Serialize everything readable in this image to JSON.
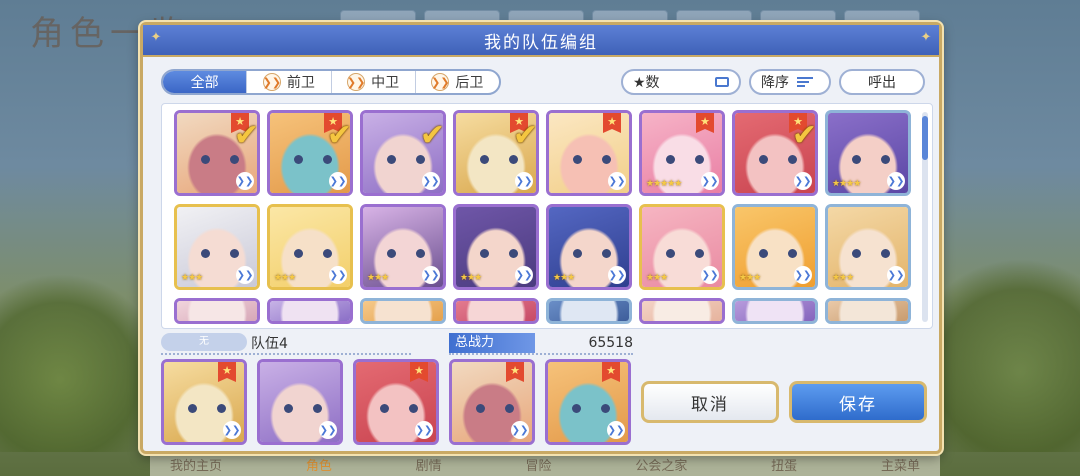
{
  "background": {
    "title": "角色一览",
    "bottom_nav": [
      "我的主页",
      "角色",
      "剧情",
      "冒险",
      "公会之家",
      "扭蛋",
      "主菜单"
    ],
    "active_nav": "角色"
  },
  "dialog": {
    "title": "我的队伍编组",
    "filter_tabs": [
      {
        "label": "全部",
        "active": true
      },
      {
        "label": "前卫",
        "active": false
      },
      {
        "label": "中卫",
        "active": false
      },
      {
        "label": "后卫",
        "active": false
      }
    ],
    "sort_field": "★数",
    "sort_order": "降序",
    "recall_label": "呼出",
    "characters": [
      {
        "frame": "purple",
        "selected": true,
        "badge": true,
        "stars": 0,
        "palette": [
          "#f1d9c0",
          "#e8a77b",
          "#c97c86"
        ]
      },
      {
        "frame": "purple",
        "selected": true,
        "badge": true,
        "stars": 0,
        "palette": [
          "#f6c27a",
          "#e39a4a",
          "#7bc2c9"
        ]
      },
      {
        "frame": "purple",
        "selected": true,
        "badge": false,
        "stars": 0,
        "palette": [
          "#c9b0e6",
          "#8e6fc5",
          "#f1d4d0"
        ]
      },
      {
        "frame": "purple",
        "selected": true,
        "badge": true,
        "stars": 0,
        "palette": [
          "#f6dca0",
          "#d9a84e",
          "#f3e6c4"
        ]
      },
      {
        "frame": "purple",
        "selected": false,
        "badge": true,
        "stars": 0,
        "palette": [
          "#fbe7c2",
          "#f2cf89",
          "#f6c0b4"
        ]
      },
      {
        "frame": "purple",
        "selected": false,
        "badge": true,
        "stars": 5,
        "palette": [
          "#f6b3c7",
          "#e97fa4",
          "#f9dde6"
        ]
      },
      {
        "frame": "purple",
        "selected": true,
        "badge": true,
        "stars": 0,
        "palette": [
          "#e46a72",
          "#c94450",
          "#f3c2c2"
        ]
      },
      {
        "frame": "silver",
        "selected": false,
        "badge": false,
        "stars": 4,
        "palette": [
          "#8a6fc9",
          "#5b47a5",
          "#f4cfc7"
        ]
      },
      {
        "frame": "gold",
        "selected": false,
        "badge": false,
        "stars": 3,
        "palette": [
          "#f1f1f4",
          "#c9c9d8",
          "#f5dcd3"
        ]
      },
      {
        "frame": "gold",
        "selected": false,
        "badge": false,
        "stars": 3,
        "palette": [
          "#fbe7a6",
          "#f3cf6a",
          "#f6e0c8"
        ]
      },
      {
        "frame": "purple",
        "selected": false,
        "badge": false,
        "stars": 3,
        "palette": [
          "#d8b3e6",
          "#6a4f8f",
          "#f3d5d5"
        ]
      },
      {
        "frame": "purple",
        "selected": false,
        "badge": false,
        "stars": 3,
        "palette": [
          "#6f56a8",
          "#4a3b7e",
          "#f4d6cb"
        ]
      },
      {
        "frame": "purple",
        "selected": false,
        "badge": false,
        "stars": 3,
        "palette": [
          "#5467c2",
          "#2f3f8f",
          "#f4d6cb"
        ]
      },
      {
        "frame": "gold",
        "selected": false,
        "badge": false,
        "stars": 3,
        "palette": [
          "#f6b5c2",
          "#e98aa1",
          "#f8dcd7"
        ]
      },
      {
        "frame": "silver",
        "selected": false,
        "badge": false,
        "stars": 3,
        "palette": [
          "#f9c66a",
          "#ef9e2f",
          "#f8e1c5"
        ]
      },
      {
        "frame": "silver",
        "selected": false,
        "badge": false,
        "stars": 3,
        "palette": [
          "#f4d8a6",
          "#e3b46a",
          "#f6e2d0"
        ]
      },
      {
        "frame": "purple",
        "selected": false,
        "badge": false,
        "stars": 0,
        "palette": [
          "#f1d5dc",
          "#d7a7b8",
          "#f6e6e6"
        ]
      },
      {
        "frame": "purple",
        "selected": false,
        "badge": false,
        "stars": 0,
        "palette": [
          "#c7b3e6",
          "#8b6fc7",
          "#efe2f2"
        ]
      },
      {
        "frame": "silver",
        "selected": false,
        "badge": false,
        "stars": 0,
        "palette": [
          "#f5c98a",
          "#e5a14c",
          "#f6e2d0"
        ]
      },
      {
        "frame": "purple",
        "selected": false,
        "badge": false,
        "stars": 0,
        "palette": [
          "#e37b8f",
          "#c74a66",
          "#f6d6d6"
        ]
      },
      {
        "frame": "silver",
        "selected": false,
        "badge": false,
        "stars": 0,
        "palette": [
          "#6a8ec7",
          "#3e5e9b",
          "#dfe7f3"
        ]
      },
      {
        "frame": "purple",
        "selected": false,
        "badge": false,
        "stars": 0,
        "palette": [
          "#f3d3c6",
          "#e6b39d",
          "#f8ece4"
        ]
      },
      {
        "frame": "silver",
        "selected": false,
        "badge": false,
        "stars": 0,
        "palette": [
          "#b79bdc",
          "#8565bd",
          "#efe3f5"
        ]
      },
      {
        "frame": "silver",
        "selected": false,
        "badge": false,
        "stars": 0,
        "palette": [
          "#e9c9a8",
          "#c99c6f",
          "#f3e6d8"
        ]
      }
    ],
    "team": {
      "label": "无",
      "name": "队伍4",
      "power_label": "总战力",
      "power_value": "65518",
      "members": [
        {
          "frame": "purple",
          "badge": true,
          "palette": [
            "#f6dca0",
            "#d9a84e",
            "#f3e6c4"
          ]
        },
        {
          "frame": "purple",
          "badge": false,
          "palette": [
            "#c9b0e6",
            "#8e6fc5",
            "#f1d4d0"
          ]
        },
        {
          "frame": "purple",
          "badge": true,
          "palette": [
            "#e46a72",
            "#c94450",
            "#f3c2c2"
          ]
        },
        {
          "frame": "purple",
          "badge": true,
          "palette": [
            "#f1d9c0",
            "#e8a77b",
            "#c97c86"
          ]
        },
        {
          "frame": "purple",
          "badge": true,
          "palette": [
            "#f6c27a",
            "#e39a4a",
            "#7bc2c9"
          ]
        }
      ]
    },
    "cancel_label": "取消",
    "save_label": "保存"
  }
}
